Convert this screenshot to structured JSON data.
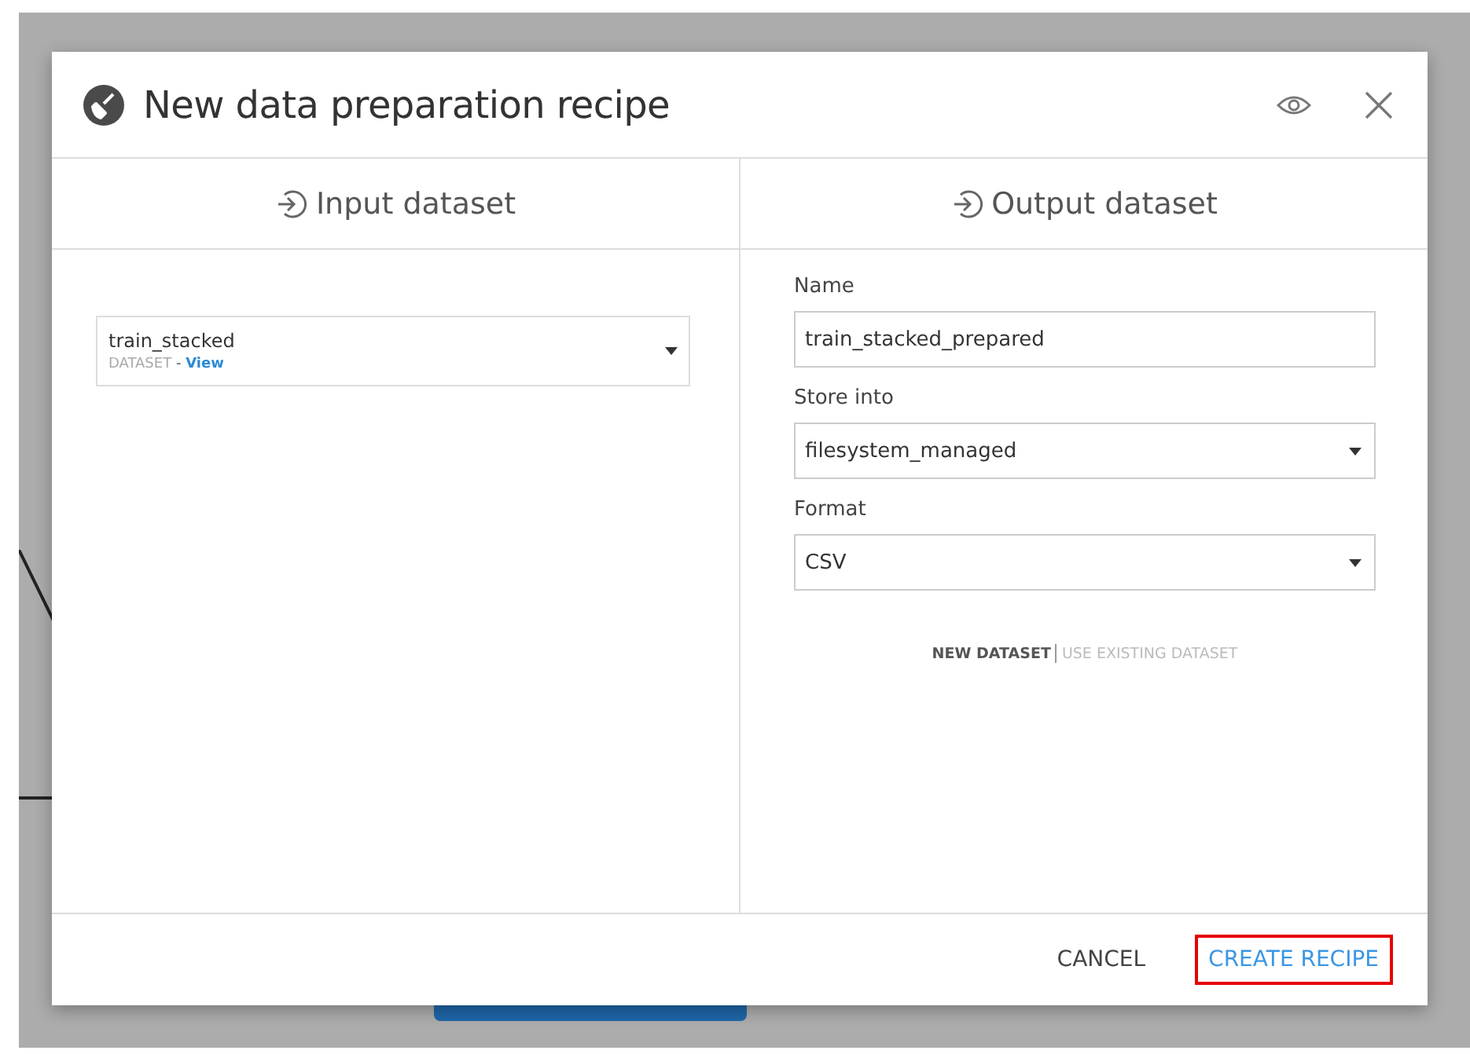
{
  "dialog": {
    "title": "New data preparation recipe"
  },
  "input": {
    "heading": "Input dataset",
    "dataset": {
      "name": "train_stacked",
      "type": "DATASET",
      "separator": "-",
      "link": "View"
    }
  },
  "output": {
    "heading": "Output dataset",
    "fields": [
      {
        "kind": "text",
        "label": "Name",
        "value": "train_stacked_prepared"
      },
      {
        "kind": "select",
        "label": "Store into",
        "value": "filesystem_managed"
      },
      {
        "kind": "select",
        "label": "Format",
        "value": "CSV"
      }
    ],
    "modes": [
      {
        "label": "NEW DATASET",
        "selected": true
      },
      {
        "label": "USE EXISTING DATASET",
        "selected": false
      }
    ]
  },
  "buttons": [
    {
      "label": "CANCEL",
      "kind": "plain",
      "highlighted": false
    },
    {
      "label": "CREATE RECIPE",
      "kind": "primary",
      "highlighted": true
    }
  ]
}
